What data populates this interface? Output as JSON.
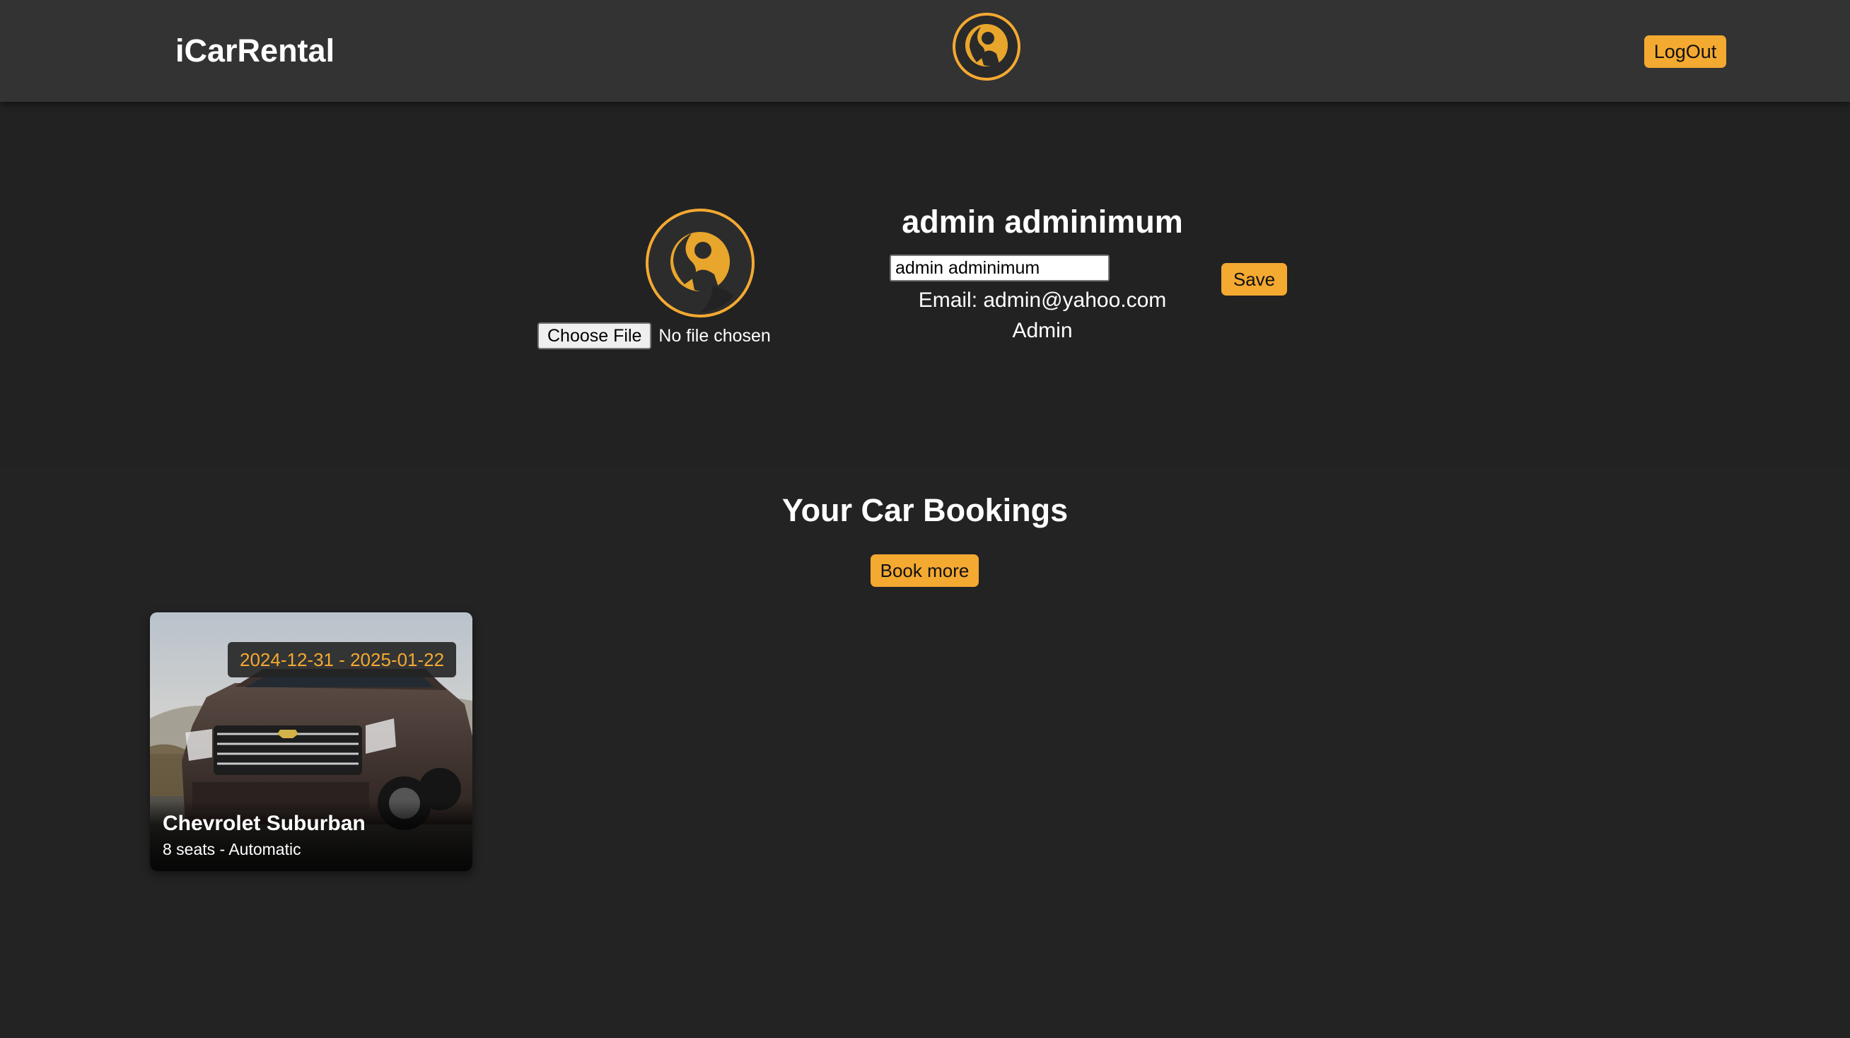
{
  "app": {
    "brand": "iCarRental"
  },
  "header": {
    "avatar_icon": "user-avatar-icon",
    "logout_label": "LogOut"
  },
  "profile": {
    "avatar_icon": "user-avatar-icon",
    "choose_file_label": "Choose File",
    "file_status": "No file chosen",
    "name": "admin adminimum",
    "name_input_value": "admin adminimum",
    "save_label": "Save",
    "email": "Email: admin@yahoo.com",
    "role": "Admin"
  },
  "bookings": {
    "title": "Your Car Bookings",
    "book_more_label": "Book more",
    "items": [
      {
        "dates": "2024-12-31 - 2025-01-22",
        "car_name": "Chevrolet Suburban",
        "specs": "8 seats - Automatic"
      }
    ]
  },
  "colors": {
    "accent": "#f4a931",
    "header_bg": "#333333",
    "page_bg": "#222222"
  }
}
